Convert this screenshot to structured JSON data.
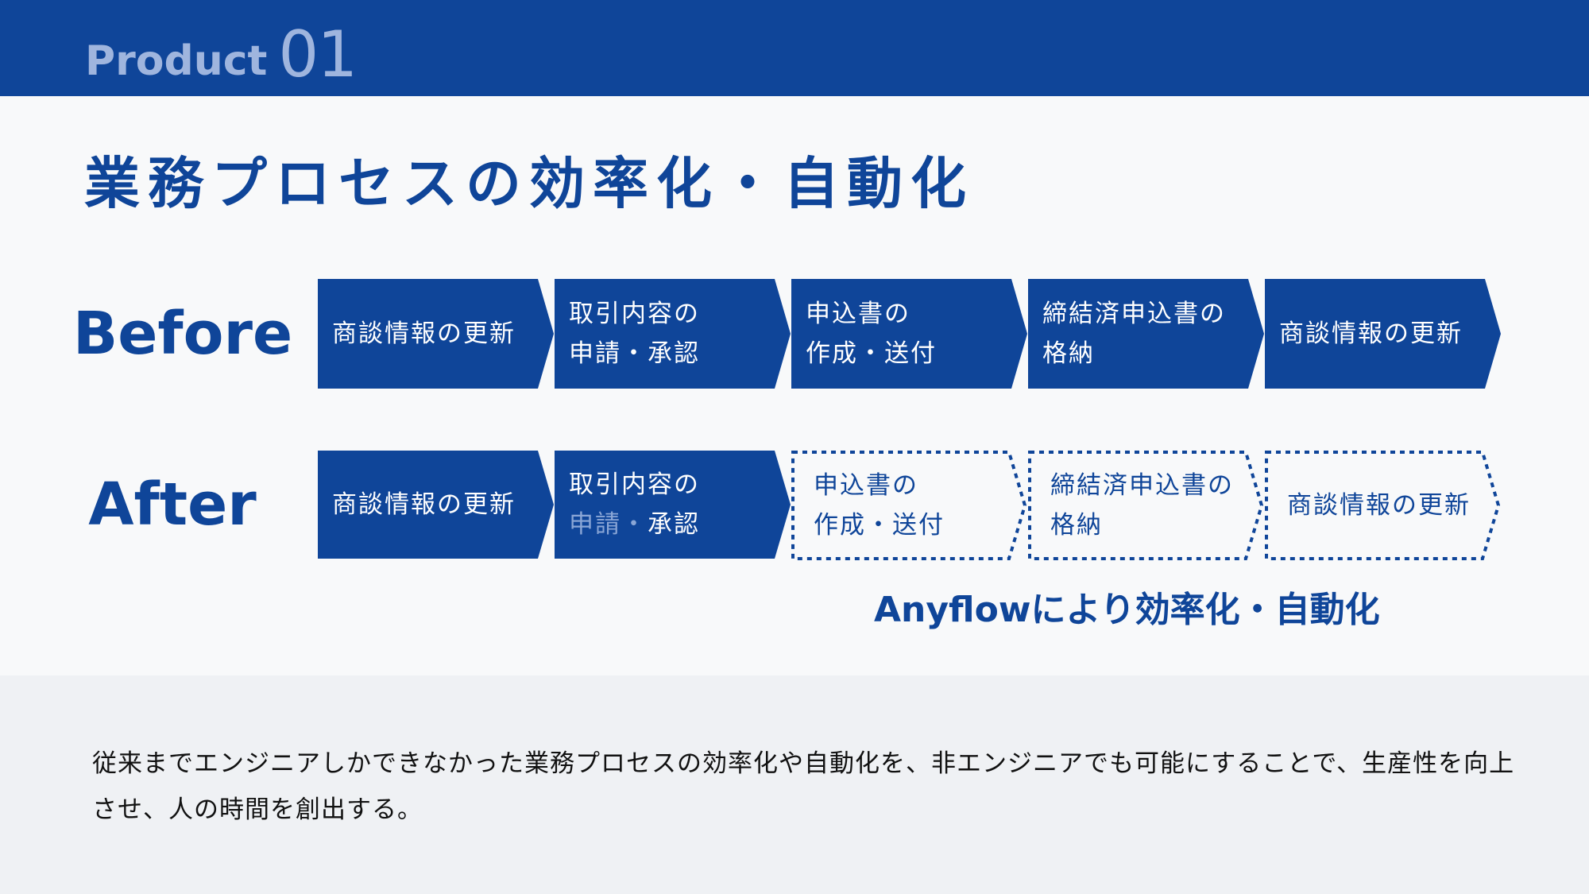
{
  "header": {
    "label_word": "Product",
    "label_number": "01"
  },
  "title": "業務プロセスの効率化・自動化",
  "colors": {
    "brand": "#0f4599",
    "header_text": "#9fb5de",
    "faded_text": "#8aa6d6",
    "background": "#f8f9fa",
    "footer_background": "#eff1f4"
  },
  "before": {
    "label": "Before",
    "steps": [
      {
        "lines": [
          "商談情報の更新"
        ]
      },
      {
        "lines": [
          "取引内容の",
          "申請・承認"
        ]
      },
      {
        "lines": [
          "申込書の",
          "作成・送付"
        ]
      },
      {
        "lines": [
          "締結済申込書の",
          "格納"
        ]
      },
      {
        "lines": [
          "商談情報の更新"
        ]
      }
    ]
  },
  "after": {
    "label": "After",
    "steps": [
      {
        "style": "solid",
        "lines": [
          "商談情報の更新"
        ]
      },
      {
        "style": "solid",
        "line1": "取引内容の",
        "line2_faded": "申請・",
        "line2": "承認"
      },
      {
        "style": "dashed",
        "lines": [
          "申込書の",
          "作成・送付"
        ]
      },
      {
        "style": "dashed",
        "lines": [
          "締結済申込書の",
          "格納"
        ]
      },
      {
        "style": "dashed",
        "lines": [
          "商談情報の更新"
        ]
      }
    ],
    "automation_caption": "Anyflowにより効率化・自動化"
  },
  "description": "従来までエンジニアしかできなかった業務プロセスの効率化や自動化を、非エンジニアでも可能にすることで、生産性を向上させ、人の時間を創出する。"
}
